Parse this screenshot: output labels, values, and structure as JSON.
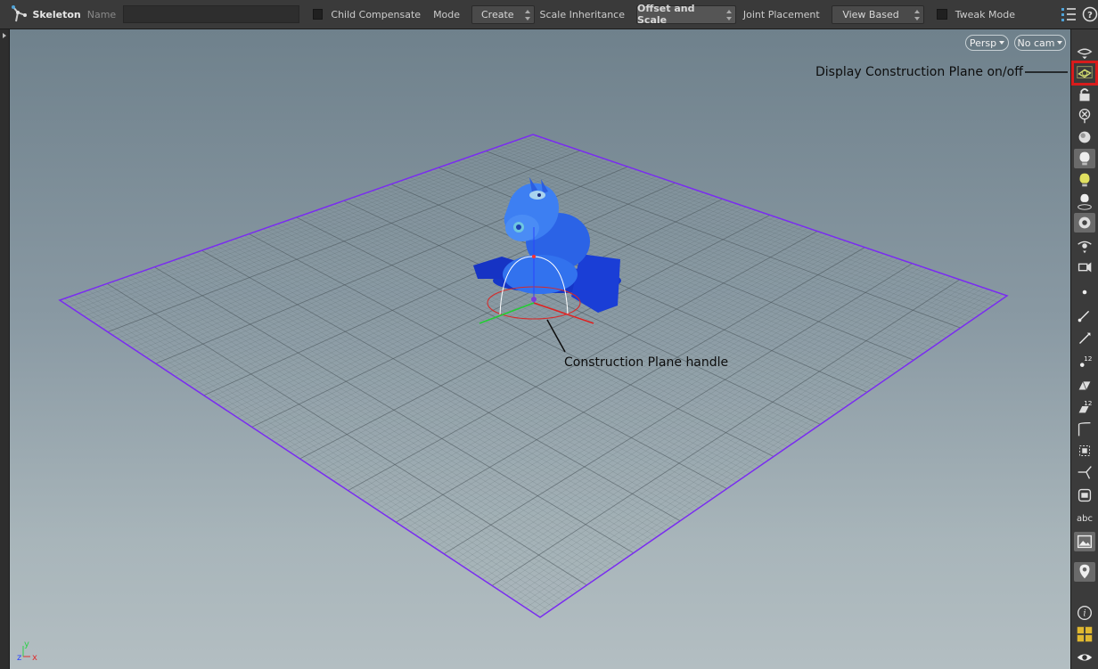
{
  "toolbar": {
    "tool_name": "Skeleton",
    "name_label": "Name",
    "name_value": "",
    "child_compensate_label": "Child Compensate",
    "mode_label": "Mode",
    "mode_value": "Create",
    "scale_inheritance_label": "Scale Inheritance",
    "scale_inheritance_value": "Offset and Scale",
    "joint_placement_label": "Joint Placement",
    "joint_placement_value": "View Based",
    "tweak_mode_label": "Tweak Mode"
  },
  "viewport": {
    "camera_view": "Persp",
    "camera_select": "No cam",
    "axis_y": "y",
    "axis_z": "z",
    "axis_x": "x",
    "grid_border_color": "#7a2cf0"
  },
  "annotations": {
    "construction_plane_toggle": "Display Construction Plane on/off",
    "construction_plane_handle": "Construction Plane handle"
  },
  "right_toolbar": {
    "items": [
      {
        "name": "display-options-icon"
      },
      {
        "name": "construction-plane-icon"
      },
      {
        "name": "lock-camera-icon"
      },
      {
        "name": "snap-icon"
      },
      {
        "name": "shading-icon"
      },
      {
        "name": "light-icon"
      },
      {
        "name": "headlight-icon"
      },
      {
        "name": "point-light-icon"
      },
      {
        "name": "camera-icon"
      },
      {
        "name": "display-guides-icon"
      },
      {
        "name": "display-handles-icon"
      },
      {
        "name": "points-icon"
      },
      {
        "name": "normals-icon"
      },
      {
        "name": "primitive-normals-icon"
      },
      {
        "name": "point-numbers-icon"
      },
      {
        "name": "edges-icon"
      },
      {
        "name": "primitive-numbers-icon"
      },
      {
        "name": "curve-icon"
      },
      {
        "name": "bounding-box-icon"
      },
      {
        "name": "vector-icon"
      },
      {
        "name": "hide-other-icon"
      },
      {
        "name": "text-icon"
      },
      {
        "name": "background-image-icon"
      },
      {
        "name": "pin-icon"
      },
      {
        "name": "info-icon"
      },
      {
        "name": "layout-icon"
      },
      {
        "name": "visibility-icon"
      }
    ],
    "text_item_label": "abc"
  }
}
